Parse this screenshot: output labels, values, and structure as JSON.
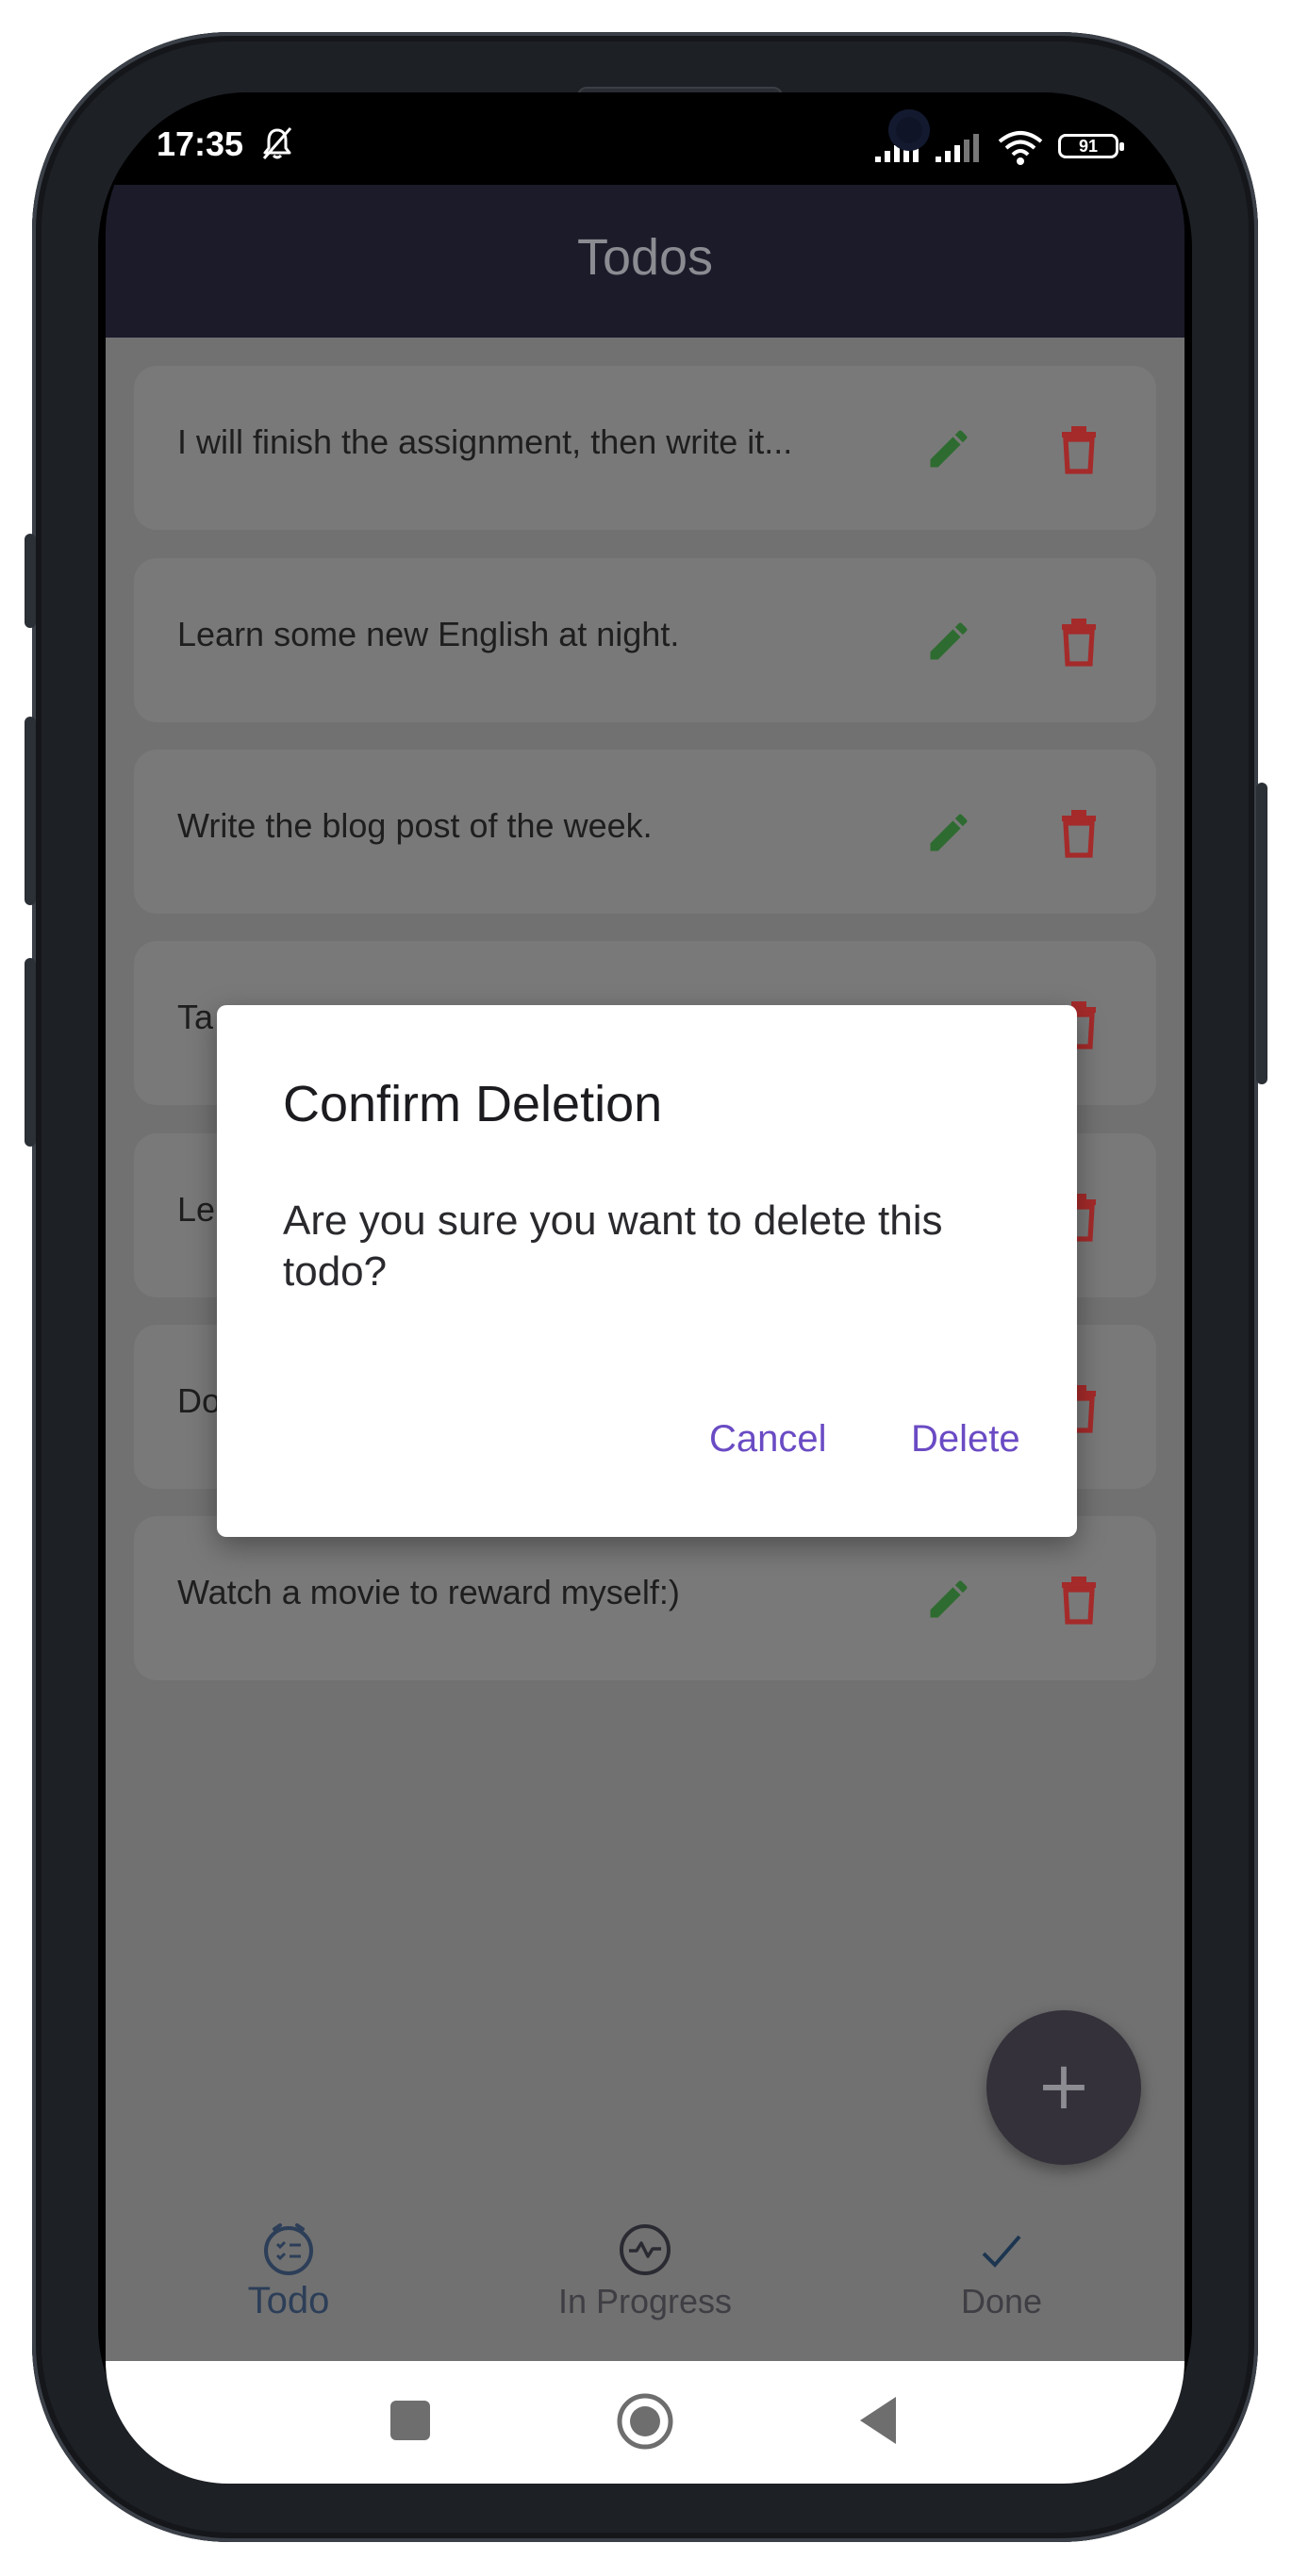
{
  "status_bar": {
    "time": "17:35",
    "battery": "91"
  },
  "app_bar": {
    "title": "Todos"
  },
  "todos": [
    {
      "text": "I will finish the assignment, then write it..."
    },
    {
      "text": "Learn some new English at night."
    },
    {
      "text": "Write the blog post of the week."
    },
    {
      "text": "Ta"
    },
    {
      "text": "Le"
    },
    {
      "text": "Do"
    },
    {
      "text": "Watch a movie to reward myself:)"
    }
  ],
  "dialog": {
    "title": "Confirm Deletion",
    "message": "Are you sure you want to delete this todo?",
    "cancel_label": "Cancel",
    "delete_label": "Delete"
  },
  "fab": {
    "label": "+"
  },
  "bottom_nav": {
    "items": [
      {
        "label": "Todo",
        "icon": "todo-list-icon",
        "active": true
      },
      {
        "label": "In Progress",
        "icon": "activity-icon",
        "active": false
      },
      {
        "label": "Done",
        "icon": "check-icon",
        "active": false
      }
    ]
  },
  "colors": {
    "edit_icon": "#2e7d32",
    "delete_icon": "#c62828",
    "dialog_action": "#6a4bc4",
    "app_bar": "#1b1b2a",
    "scrim": "#717171"
  }
}
